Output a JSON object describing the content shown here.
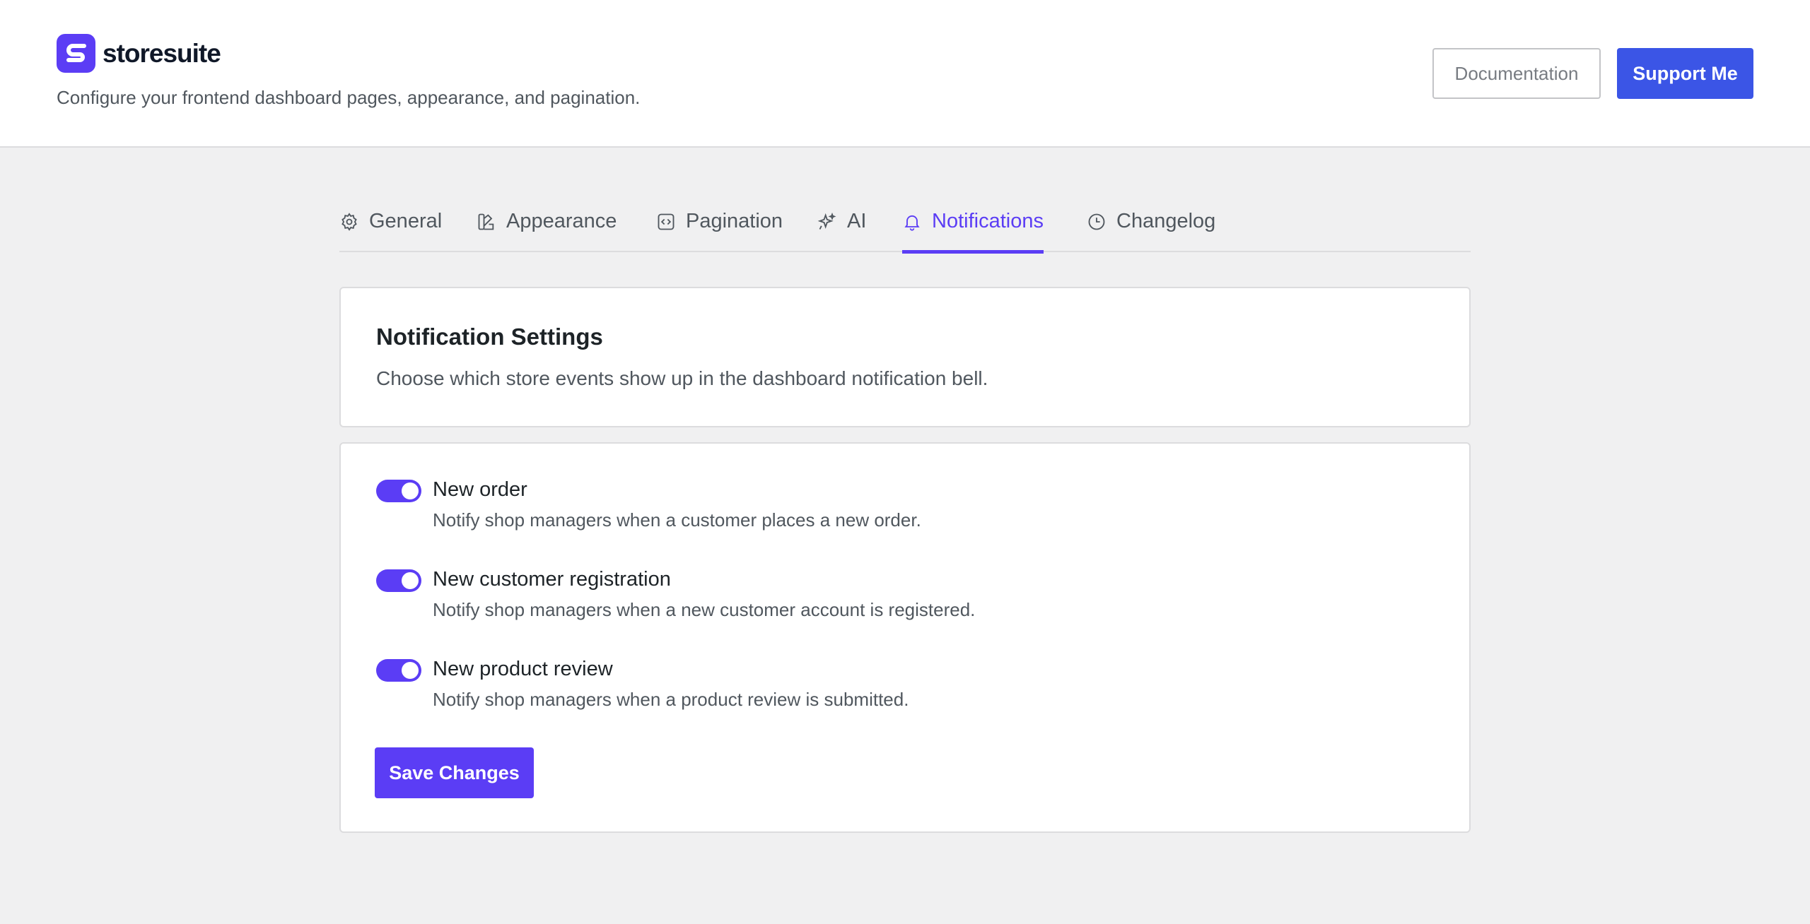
{
  "header": {
    "brand_name": "storesuite",
    "subtitle": "Configure your frontend dashboard pages, appearance, and pagination.",
    "documentation_label": "Documentation",
    "support_label": "Support Me"
  },
  "tabs": [
    {
      "label": "General",
      "icon": "gear-icon"
    },
    {
      "label": "Appearance",
      "icon": "palette-icon"
    },
    {
      "label": "Pagination",
      "icon": "code-icon"
    },
    {
      "label": "AI",
      "icon": "sparkle-icon"
    },
    {
      "label": "Notifications",
      "icon": "bell-icon",
      "active": true
    },
    {
      "label": "Changelog",
      "icon": "clock-icon"
    }
  ],
  "settings": {
    "title": "Notification Settings",
    "description": "Choose which store events show up in the dashboard notification bell.",
    "options": [
      {
        "label": "New order",
        "description": "Notify shop managers when a customer places a new order.",
        "enabled": true
      },
      {
        "label": "New customer registration",
        "description": "Notify shop managers when a new customer account is registered.",
        "enabled": true
      },
      {
        "label": "New product review",
        "description": "Notify shop managers when a product review is submitted.",
        "enabled": true
      }
    ],
    "save_label": "Save Changes"
  },
  "colors": {
    "accent": "#5b3df5",
    "support_button": "#3b55e6",
    "background": "#f0f0f1"
  }
}
